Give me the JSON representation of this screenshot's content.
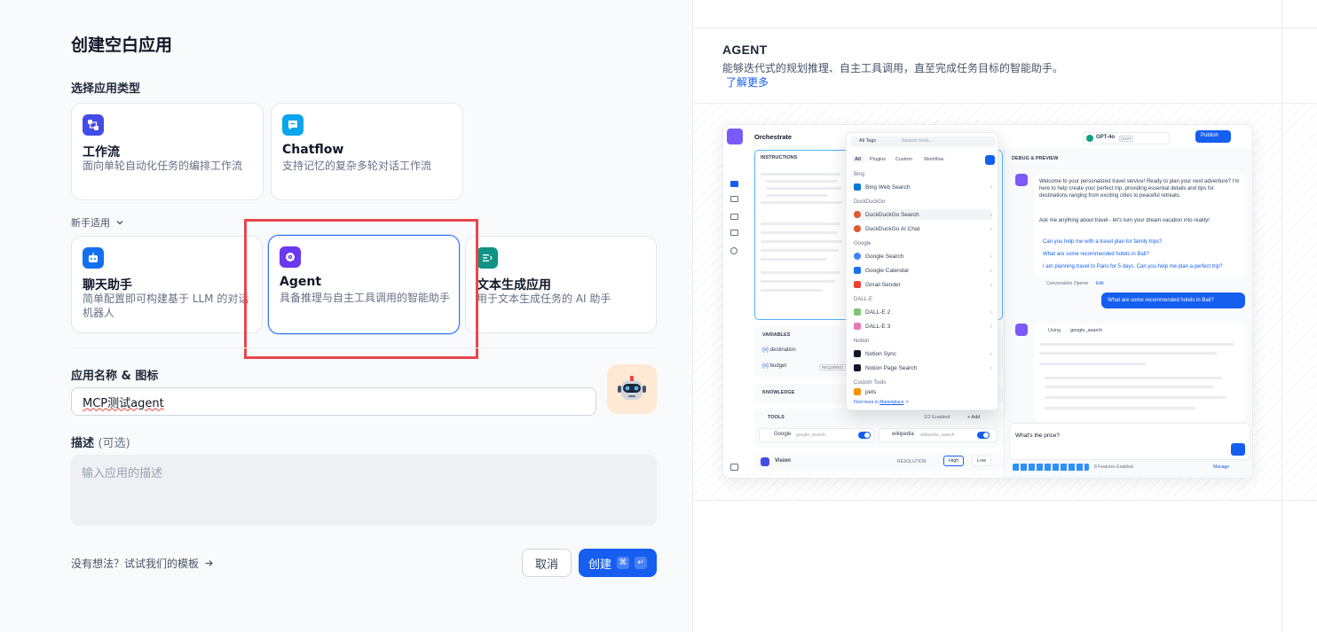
{
  "page_title": "创建空白应用",
  "app_type_label": "选择应用类型",
  "app_types_primary": [
    {
      "name": "工作流",
      "desc": "面向单轮自动化任务的编排工作流",
      "icon": "workflow-icon",
      "color": "#444ce7"
    },
    {
      "name": "Chatflow",
      "desc": "支持记忆的复杂多轮对话工作流",
      "icon": "chatflow-icon",
      "color": "#0ba5ec"
    }
  ],
  "beginner_label": "新手适用",
  "app_types_beginner": [
    {
      "name": "聊天助手",
      "desc": "简单配置即可构建基于 LLM 的对话机器人",
      "icon": "chat-bot-icon",
      "color": "#1570ef"
    },
    {
      "name": "Agent",
      "desc": "具备推理与自主工具调用的智能助手",
      "icon": "agent-icon",
      "color": "#6938ef"
    },
    {
      "name": "文本生成应用",
      "desc": "用于文本生成任务的 AI 助手",
      "icon": "text-generator-icon",
      "color": "#0e9384"
    }
  ],
  "name_label": "应用名称 & 图标",
  "name_value": "MCP测试agent",
  "desc_label": "描述",
  "desc_optional": "(可选)",
  "desc_placeholder": "输入应用的描述",
  "template_link": "没有想法？试试我们的模板",
  "cancel_label": "取消",
  "create_label": "创建",
  "create_shortcut": [
    "⌘",
    "↵"
  ],
  "preview": {
    "title": "AGENT",
    "desc": "能够迭代式的规划推理、自主工具调用，直至完成任务目标的智能助手。",
    "learn_more": "了解更多",
    "mock": {
      "orchestrate": "Orchestrate",
      "instructions": "INSTRUCTIONS",
      "variables": "VARIABLES",
      "var_destination": "destination",
      "var_budget": "budget",
      "required": "REQUIRED",
      "knowledge": "KNOWLEDGE",
      "tools": "TOOLS",
      "tools_enabled": "2/2 Enabled",
      "add": "+ Add",
      "tool_google": "Google",
      "tool_google_id": "google_search",
      "tool_wiki": "wikipedia",
      "tool_wiki_id": "wikipedia_search",
      "vision": "Vision",
      "resolution": "RESOLUTION",
      "high": "High",
      "low": "Low",
      "model": "GPT-4o",
      "chat_badge": "CHAT",
      "publish": "Publish",
      "debug_preview": "DEBUG & PREVIEW",
      "welcome": "Welcome to your personalized travel service! Ready to plan your next adventure? I'm here to help create your perfect trip, providing essential details and tips for destinations ranging from exciting cities to peaceful retreats.",
      "ask": "Ask me anything about travel - let's turn your dream vacation into reality!",
      "suggestions": [
        "Can you help me with a travel plan for family trips?",
        "What are some recommended hotels in Bali?",
        "I am planning travel to Paris for 5 days. Can you help me plan a perfect trip?"
      ],
      "opener": "Conversation Opener",
      "edit": "Edit",
      "user_msg": "What are some recommended hotels in Bali?",
      "using": "Using",
      "using_tool": "google_search",
      "input": "What's the price?",
      "features": "8 Features Enabled",
      "manage": "Manage",
      "dropdown": {
        "all_tags": "All Tags",
        "search": "Search tools...",
        "tabs": [
          "All",
          "Plugins",
          "Custom",
          "Workflow"
        ],
        "groups": [
          {
            "name": "Bing",
            "items": [
              "Bing Web Search"
            ]
          },
          {
            "name": "DuckDuckGo",
            "items": [
              "DuckDuckGo Search",
              "DuckDuckGo AI Chat"
            ]
          },
          {
            "name": "Google",
            "items": [
              "Google Search",
              "Google Calendar",
              "Gmail Sender"
            ]
          },
          {
            "name": "DALL-E",
            "items": [
              "DALL-E 2",
              "DALL-E 3"
            ]
          },
          {
            "name": "Notion",
            "items": [
              "Notion Sync",
              "Notion Page Search"
            ]
          },
          {
            "name": "Custom Tools",
            "items": [
              "pets"
            ]
          }
        ],
        "find_more": "Find more in",
        "marketplace": "Marketplace"
      }
    }
  }
}
